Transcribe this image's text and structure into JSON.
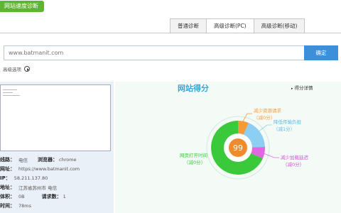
{
  "badge": "网站速度诊断",
  "tabs": [
    "普通诊断",
    "高级诊断(PC)",
    "高级诊断(移动)"
  ],
  "url_input": {
    "placeholder": "www.batmanit.com"
  },
  "confirm_label": "确定",
  "advanced_options_label": "高级选项",
  "info": [
    {
      "key": "线路：",
      "value": "电信",
      "key2": "浏览器：",
      "value2": "chrome"
    },
    {
      "key": "网址：",
      "value": "https://www.batmanit.com"
    },
    {
      "key": "IP：",
      "value": "58.211.137.80"
    },
    {
      "key": "地址：",
      "value": "江苏省苏州市 电信"
    },
    {
      "key": "体积：",
      "value": "0B",
      "key2": "请求数：",
      "value2": "1"
    },
    {
      "key": "时间：",
      "value": "78ms"
    }
  ],
  "score": {
    "title": "网站得分",
    "detail_link": "得分详情",
    "value": "99",
    "colors": {
      "green": "#39c93a",
      "orange": "#f39a3a",
      "blue": "#8ccff2",
      "magenta": "#e067e0"
    },
    "segments": [
      {
        "name": "网页打开时间",
        "sub": "（减0分）",
        "color": "#39c93a"
      },
      {
        "name": "减少资源请求",
        "sub": "（减0分）",
        "color": "#f39a3a"
      },
      {
        "name": "降低传输负担",
        "sub": "（减1分）",
        "color": "#8ccff2"
      },
      {
        "name": "减少加载延迟",
        "sub": "（减0分）",
        "color": "#e067e0"
      }
    ]
  }
}
